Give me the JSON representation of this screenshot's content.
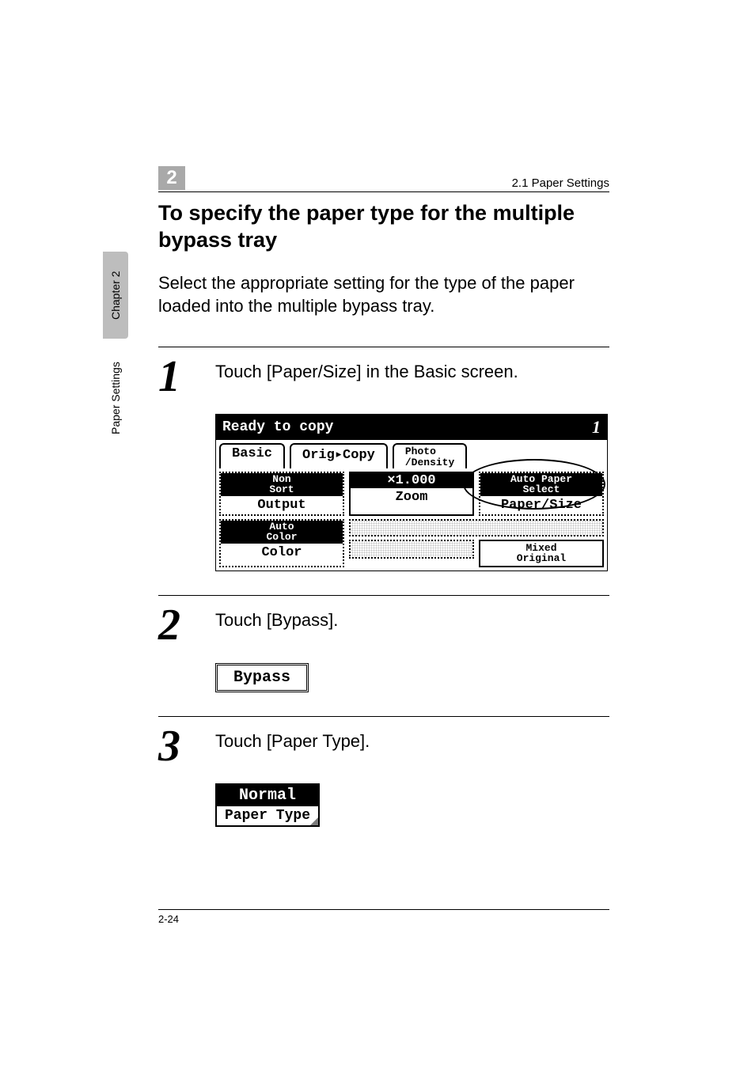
{
  "sidebar": {
    "chapter_tab": "Chapter 2",
    "section_tab": "Paper Settings"
  },
  "header": {
    "chapter_number": "2",
    "breadcrumb": "2.1 Paper Settings"
  },
  "section": {
    "title": "To specify the paper type for the multiple bypass tray",
    "intro": "Select the appropriate setting for the type of the paper loaded into the multiple bypass tray."
  },
  "steps": [
    {
      "num": "1",
      "text": "Touch [Paper/Size] in the Basic screen."
    },
    {
      "num": "2",
      "text": "Touch [Bypass]."
    },
    {
      "num": "3",
      "text": "Touch [Paper Type]."
    }
  ],
  "screen": {
    "title": "Ready to copy",
    "count": "1",
    "tabs": {
      "basic": "Basic",
      "orig_copy": "Orig▸Copy",
      "photo_density": "Photo\n/Density"
    },
    "cells": {
      "non_sort": "Non\nSort",
      "output": "Output",
      "zoom_val": "×1.000",
      "zoom": "Zoom",
      "auto_paper_select": "Auto Paper\nSelect",
      "paper_size": "Paper/Size",
      "auto_color": "Auto\nColor",
      "color": "Color",
      "mixed_original": "Mixed\nOriginal"
    }
  },
  "bypass_button": {
    "label": "Bypass"
  },
  "paper_type_button": {
    "top": "Normal",
    "bottom": "Paper Type"
  },
  "footer": {
    "page": "2-24"
  }
}
